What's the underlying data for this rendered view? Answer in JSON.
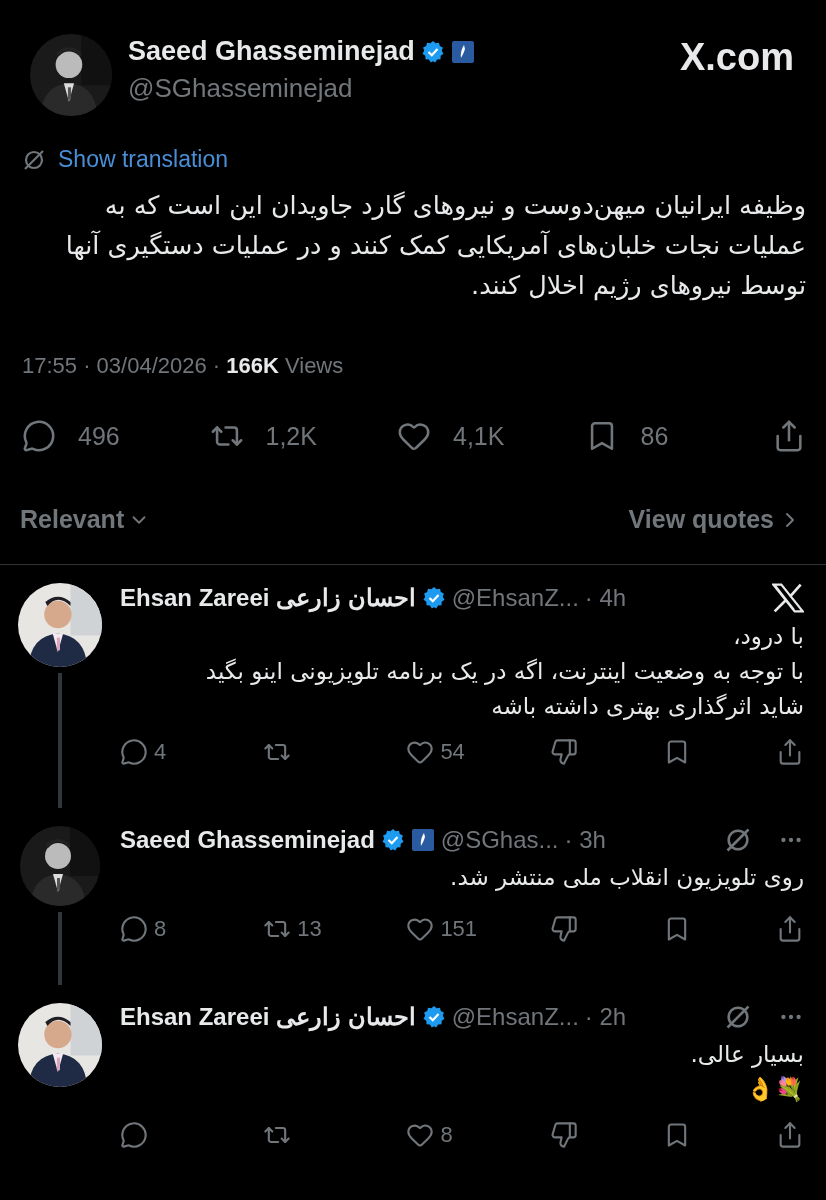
{
  "site_logo": "X.com",
  "tweet": {
    "name": "Saeed Ghasseminejad",
    "verified": true,
    "affiliate_badge": true,
    "handle": "@SGhasseminejad",
    "translate_link": "Show translation",
    "body": "وظیفه ایرانیان میهن‌دوست و نیروهای گارد جاویدان این است که به عملیات نجات خلبان‌های آمریکایی کمک کنند و در عملیات دستگیری آنها توسط نیروهای رژیم اخلال کنند.",
    "meta": "17:55 · 03/04/2026 · **166K** Views",
    "counts": {
      "reply": "496",
      "repost": "1,2K",
      "like": "4,1K",
      "bookmark": "86"
    }
  },
  "sort": {
    "label": "Relevant",
    "quotes": "View quotes"
  },
  "replies": [
    {
      "name": "Ehsan Zareei احسان زارعی",
      "verified": true,
      "affiliate_badge": false,
      "handle": "@EhsanZ...",
      "age": "· 4h",
      "corner": {
        "kind": "x-logo"
      },
      "thread_line": true,
      "lines": [
        "با درود،",
        "با توجه به وضعیت اینترنت، اگه در یک برنامه تلویزیونی اینو بگید",
        "شاید اثرگذاری بهتری داشته باشه"
      ],
      "counts": {
        "reply": "4",
        "like": "54"
      }
    },
    {
      "name": "Saeed Ghasseminejad",
      "verified": true,
      "affiliate_badge": true,
      "handle": "@SGhas...",
      "age": "· 3h",
      "corner": {
        "kind": "menu"
      },
      "thread_line": true,
      "lines": [
        "روی تلویزیون انقلاب ملی منتشر شد."
      ],
      "counts": {
        "reply": "8",
        "repost": "13",
        "like": "151"
      }
    },
    {
      "name": "Ehsan Zareei احسان زارعی",
      "verified": true,
      "affiliate_badge": false,
      "handle": "@EhsanZ...",
      "age": "· 2h",
      "corner": {
        "kind": "menu"
      },
      "thread_line": false,
      "lines": [
        "بسیار عالی.",
        "💐👌"
      ],
      "counts": {
        "like": "8"
      }
    }
  ]
}
